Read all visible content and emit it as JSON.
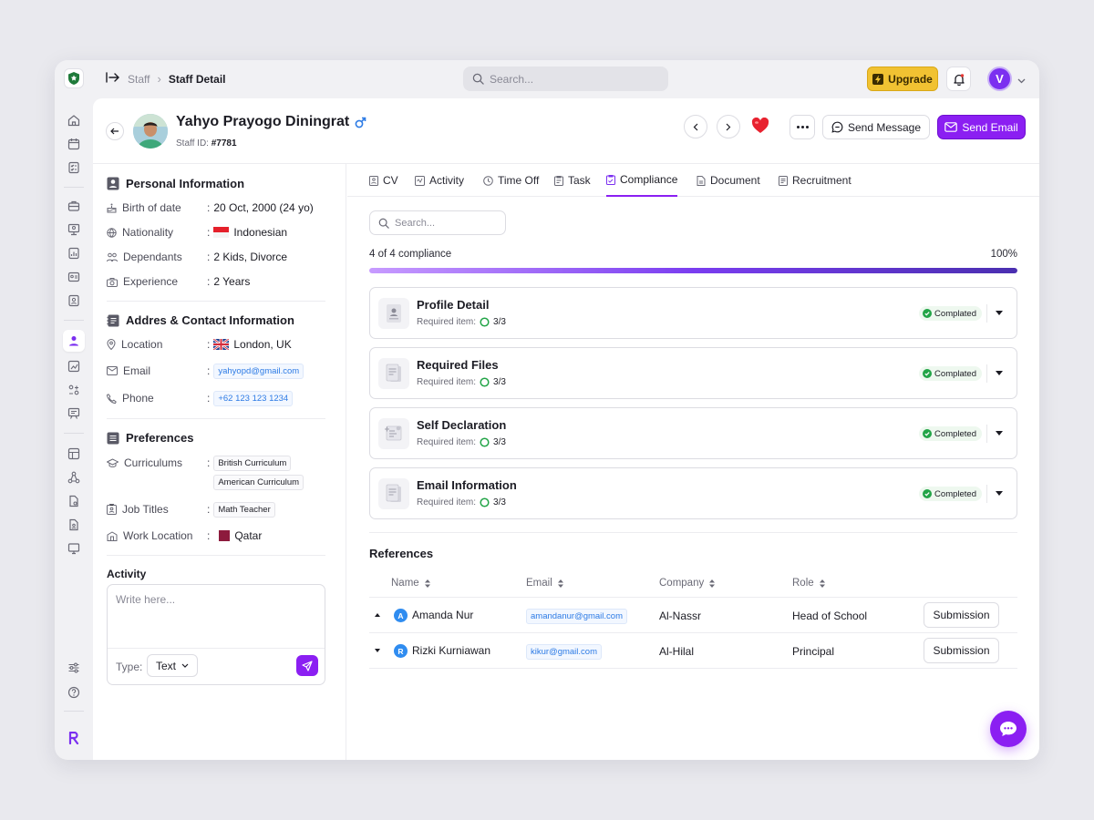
{
  "breadcrumb": {
    "parent": "Staff",
    "current": "Staff Detail"
  },
  "search": {
    "placeholder": "Search..."
  },
  "topbar": {
    "upgrade_label": "Upgrade",
    "avatar_initial": "V"
  },
  "profile": {
    "name": "Yahyo Prayogo Diningrat",
    "gender_icon": "male-symbol",
    "staff_id_label": "Staff ID:",
    "staff_id": "#7781"
  },
  "actions": {
    "send_message": "Send Message",
    "send_email": "Send Email"
  },
  "personal": {
    "title": "Personal Information",
    "fields": [
      {
        "label": "Birth of date",
        "value": "20 Oct, 2000 (24 yo)"
      },
      {
        "label": "Nationality",
        "value": "Indonesian"
      },
      {
        "label": "Dependants",
        "value": "2 Kids, Divorce"
      },
      {
        "label": "Experience",
        "value": "2 Years"
      }
    ]
  },
  "contact": {
    "title": "Addres & Contact Information",
    "location_label": "Location",
    "location": "London, UK",
    "email_label": "Email",
    "email": "yahyopd@gmail.com",
    "phone_label": "Phone",
    "phone": "+62 123 123 1234"
  },
  "preferences": {
    "title": "Preferences",
    "curriculums_label": "Curriculums",
    "curriculums": [
      "British Curriculum",
      "American Curriculum"
    ],
    "job_titles_label": "Job Titles",
    "job_title": "Math Teacher",
    "work_location_label": "Work Location",
    "work_location": "Qatar"
  },
  "activity": {
    "title": "Activity",
    "placeholder": "Write here...",
    "type_label": "Type:",
    "type_value": "Text"
  },
  "tabs": [
    "CV",
    "Activity",
    "Time Off",
    "Task",
    "Compliance",
    "Document",
    "Recruitment"
  ],
  "active_tab": "Compliance",
  "compliance": {
    "search_placeholder": "Search...",
    "progress_text": "4 of 4 compliance",
    "progress_pct": "100%",
    "progress_value": 1.0,
    "required_label": "Required item:",
    "items": [
      {
        "title": "Profile Detail",
        "count": "3/3",
        "status": "Complated"
      },
      {
        "title": "Required Files",
        "count": "3/3",
        "status": "Complated"
      },
      {
        "title": "Self Declaration",
        "count": "3/3",
        "status": "Completed"
      },
      {
        "title": "Email Information",
        "count": "3/3",
        "status": "Completed"
      }
    ]
  },
  "references": {
    "title": "References",
    "columns": [
      "Name",
      "Email",
      "Company",
      "Role"
    ],
    "rows": [
      {
        "initial": "A",
        "name": "Amanda Nur",
        "email": "amandanur@gmail.com",
        "company": "Al-Nassr",
        "role": "Head of School",
        "action": "Submission"
      },
      {
        "initial": "R",
        "name": "Rizki Kurniawan",
        "email": "kikur@gmail.com",
        "company": "Al-Hilal",
        "role": "Principal",
        "action": "Submission"
      }
    ]
  },
  "colors": {
    "accent": "#8b1ff2",
    "upgrade": "#f1c232",
    "status_green": "#22a447",
    "link_blue": "#2d7be5"
  }
}
